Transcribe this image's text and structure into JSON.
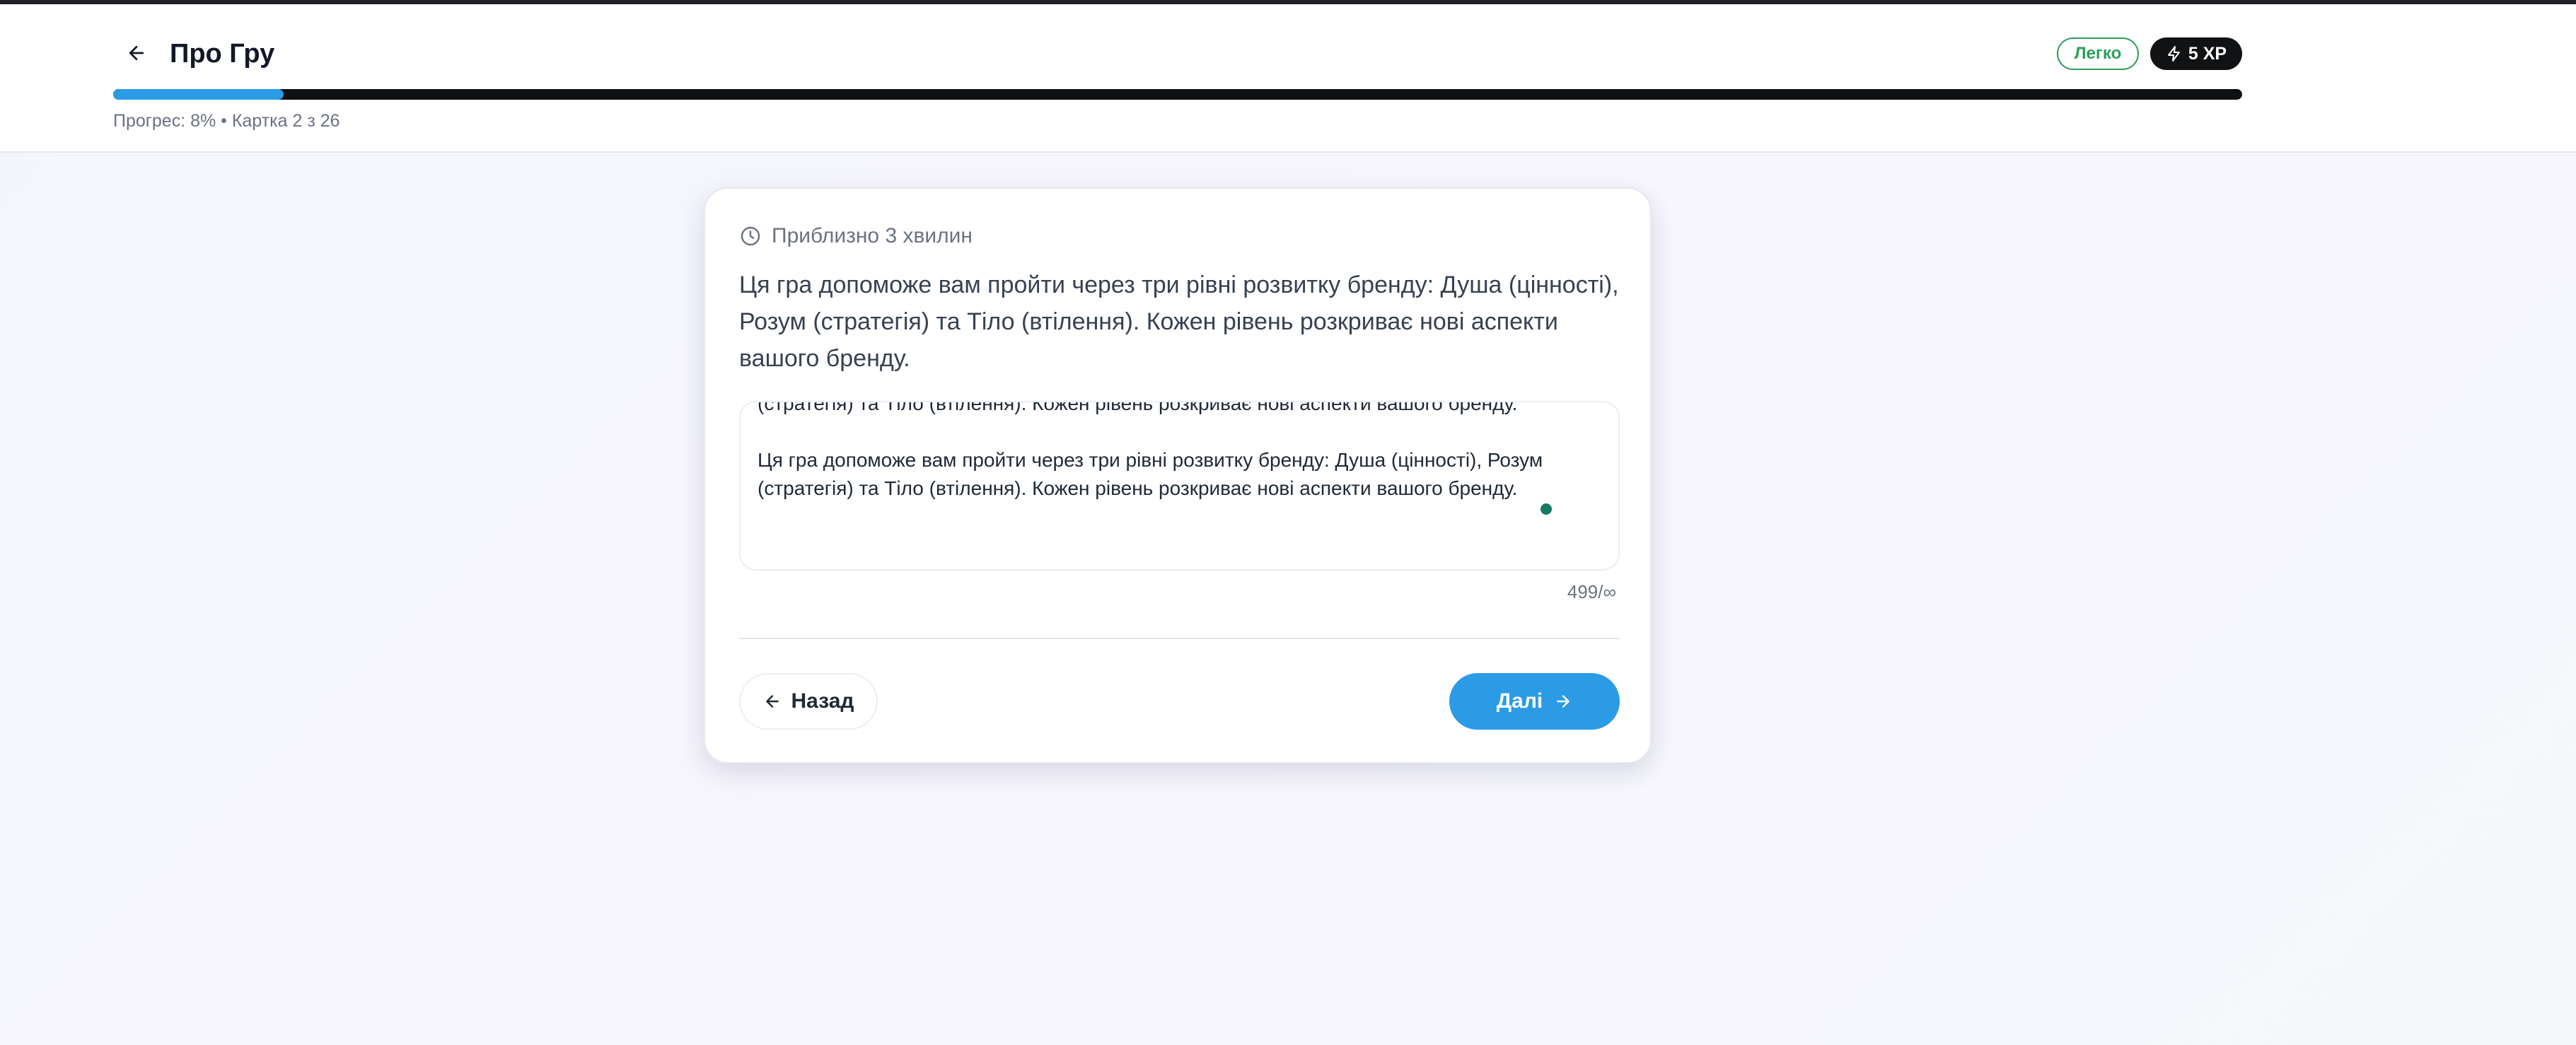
{
  "header": {
    "title": "Про Гру",
    "difficulty_badge": "Легко",
    "xp_badge": "5 XP",
    "progress_fraction": 0.08,
    "progress_text": "Прогрес: 8% • Картка 2 з 26"
  },
  "card": {
    "time_estimate": "Приблизно 3 хвилин",
    "description": "Ця гра допоможе вам пройти через три рівні розвитку бренду: Душа (цінності), Розум (стратегія) та Тіло (втілення). Кожен рівень розкриває нові аспекти вашого бренду.",
    "textarea_value": "(стратегія) та Тіло (втілення). Кожен рівень розкриває нові аспекти вашого бренду.\n\nЦя гра допоможе вам пройти через три рівні розвитку бренду: Душа (цінності), Розум\n(стратегія) та Тіло (втілення). Кожен рівень розкриває нові аспекти вашого бренду.",
    "char_counter": "499/∞",
    "back_label": "Назад",
    "next_label": "Далі"
  },
  "icons": {
    "header_back": "arrow-left-icon",
    "xp": "lightning-icon",
    "time": "clock-icon",
    "back_button": "arrow-left-icon",
    "next_button": "arrow-right-icon"
  },
  "colors": {
    "accent": "#2b9be6",
    "easy_green": "#2f9e5b",
    "xp_badge_bg": "#111214",
    "status_dot": "#177a63"
  }
}
